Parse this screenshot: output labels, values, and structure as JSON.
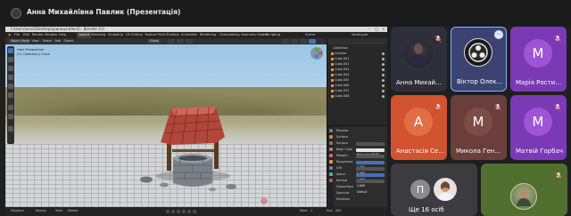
{
  "window": {
    "title": "Анна Михайлівна Павлик (Презентація)"
  },
  "blender": {
    "title_bar": "I:\\Users\\анна\\Desktop\\криниця.blend] - Blender 4.0",
    "menus": [
      "File",
      "Edit",
      "Render",
      "Window",
      "Help"
    ],
    "workspace_tabs": [
      "Layout",
      "Modeling",
      "Sculpting",
      "UV Editing",
      "Texture Paint",
      "Shading",
      "Animation",
      "Rendering",
      "Compositing",
      "Geometry Nodes",
      "Scripting"
    ],
    "scene_label": "Scene",
    "view_layer_label": "ViewLayer",
    "header_items": [
      "Object Mode",
      "View",
      "Select",
      "Add",
      "Object",
      "Global"
    ],
    "viewport_info": [
      "User Perspective",
      "(1) Collection | Cube"
    ],
    "outliner_items": [
      "Collection",
      "Camera",
      "Cube.001",
      "Cube.002",
      "Cube.003",
      "Cube.004",
      "Cube.005",
      "Cube.006",
      "Cube.007",
      "Cube.008"
    ],
    "properties": {
      "sections": [
        "Preview",
        "Surface"
      ],
      "rows": [
        {
          "label": "Surface",
          "value": "Principled BSDF"
        },
        {
          "label": "Base Color",
          "value": ""
        },
        {
          "label": "Metallic",
          "value": "0.000"
        },
        {
          "label": "Roughness",
          "value": "0.500"
        },
        {
          "label": "IOR",
          "value": "1.500"
        },
        {
          "label": "Alpha",
          "value": "1.000"
        },
        {
          "label": "Normal",
          "value": "Default"
        },
        {
          "label": "Subsurface",
          "value": ""
        },
        {
          "label": "Specular",
          "value": ""
        },
        {
          "label": "Emission",
          "value": ""
        }
      ]
    },
    "timeline": {
      "labels": [
        "Playback",
        "Keying",
        "View",
        "Marker"
      ],
      "start_label": "Start",
      "start": "1",
      "end_label": "End",
      "end": "250"
    }
  },
  "participants": [
    {
      "name": "Анна Михайл...",
      "muted": true
    },
    {
      "name": "Віктор Олекс...",
      "muted": false,
      "app_icon": "obs-icon"
    },
    {
      "name": "Марія Ростис...",
      "initial": "М",
      "muted": true
    },
    {
      "name": "Анастасія Се...",
      "initial": "А",
      "muted": true
    },
    {
      "name": "Микола Генн...",
      "initial": "М",
      "muted": true
    },
    {
      "name": "Матвій Горбач",
      "initial": "М",
      "muted": true
    },
    {
      "name": "Ще 16 осіб",
      "initial": "П"
    },
    {
      "name": "",
      "muted": true
    }
  ],
  "colors": {
    "tile_dark": "#2f2f3a",
    "tile_orange": "#d2532f",
    "tile_brown": "#6a3f3b",
    "tile_purple": "#7a3ab5",
    "tile_selected_border": "#8ab4f8"
  }
}
